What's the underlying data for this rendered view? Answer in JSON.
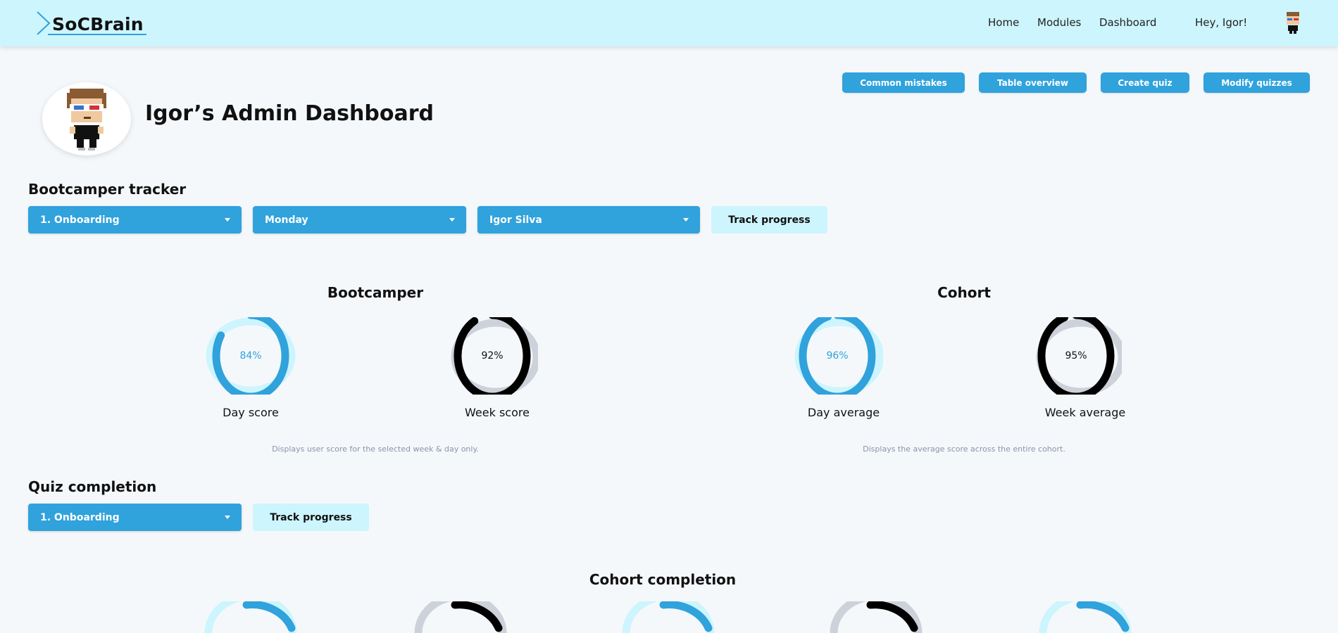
{
  "nav": {
    "brand": "SoCBrain",
    "links": [
      "Home",
      "Modules",
      "Dashboard"
    ],
    "greeting": "Hey, Igor!"
  },
  "header": {
    "title": "Igor’s Admin Dashboard",
    "buttons": [
      "Common mistakes",
      "Table overview",
      "Create quiz",
      "Modify quizzes"
    ]
  },
  "tracker": {
    "title": "Bootcamper tracker",
    "module": "1. Onboarding",
    "day": "Monday",
    "bootcamper": "Igor Silva",
    "track_label": "Track progress"
  },
  "bootcamper": {
    "title": "Bootcamper",
    "day_score": {
      "label": "Day score",
      "value": 84,
      "text": "84%"
    },
    "week_score": {
      "label": "Week score",
      "value": 92,
      "text": "92%"
    },
    "note": "Displays user score for the selected week & day only."
  },
  "cohort": {
    "title": "Cohort",
    "day_average": {
      "label": "Day average",
      "value": 96,
      "text": "96%"
    },
    "week_average": {
      "label": "Week average",
      "value": 95,
      "text": "95%"
    },
    "note": "Displays the average score across the entire cohort."
  },
  "quiz": {
    "title": "Quiz completion",
    "module": "1. Onboarding",
    "track_label": "Track progress"
  },
  "completion": {
    "title": "Cohort completion"
  },
  "colors": {
    "accent": "#30a2dc",
    "light_accent": "#cdf5fd",
    "dark": "#000000",
    "track_grey": "#cdd1da"
  }
}
